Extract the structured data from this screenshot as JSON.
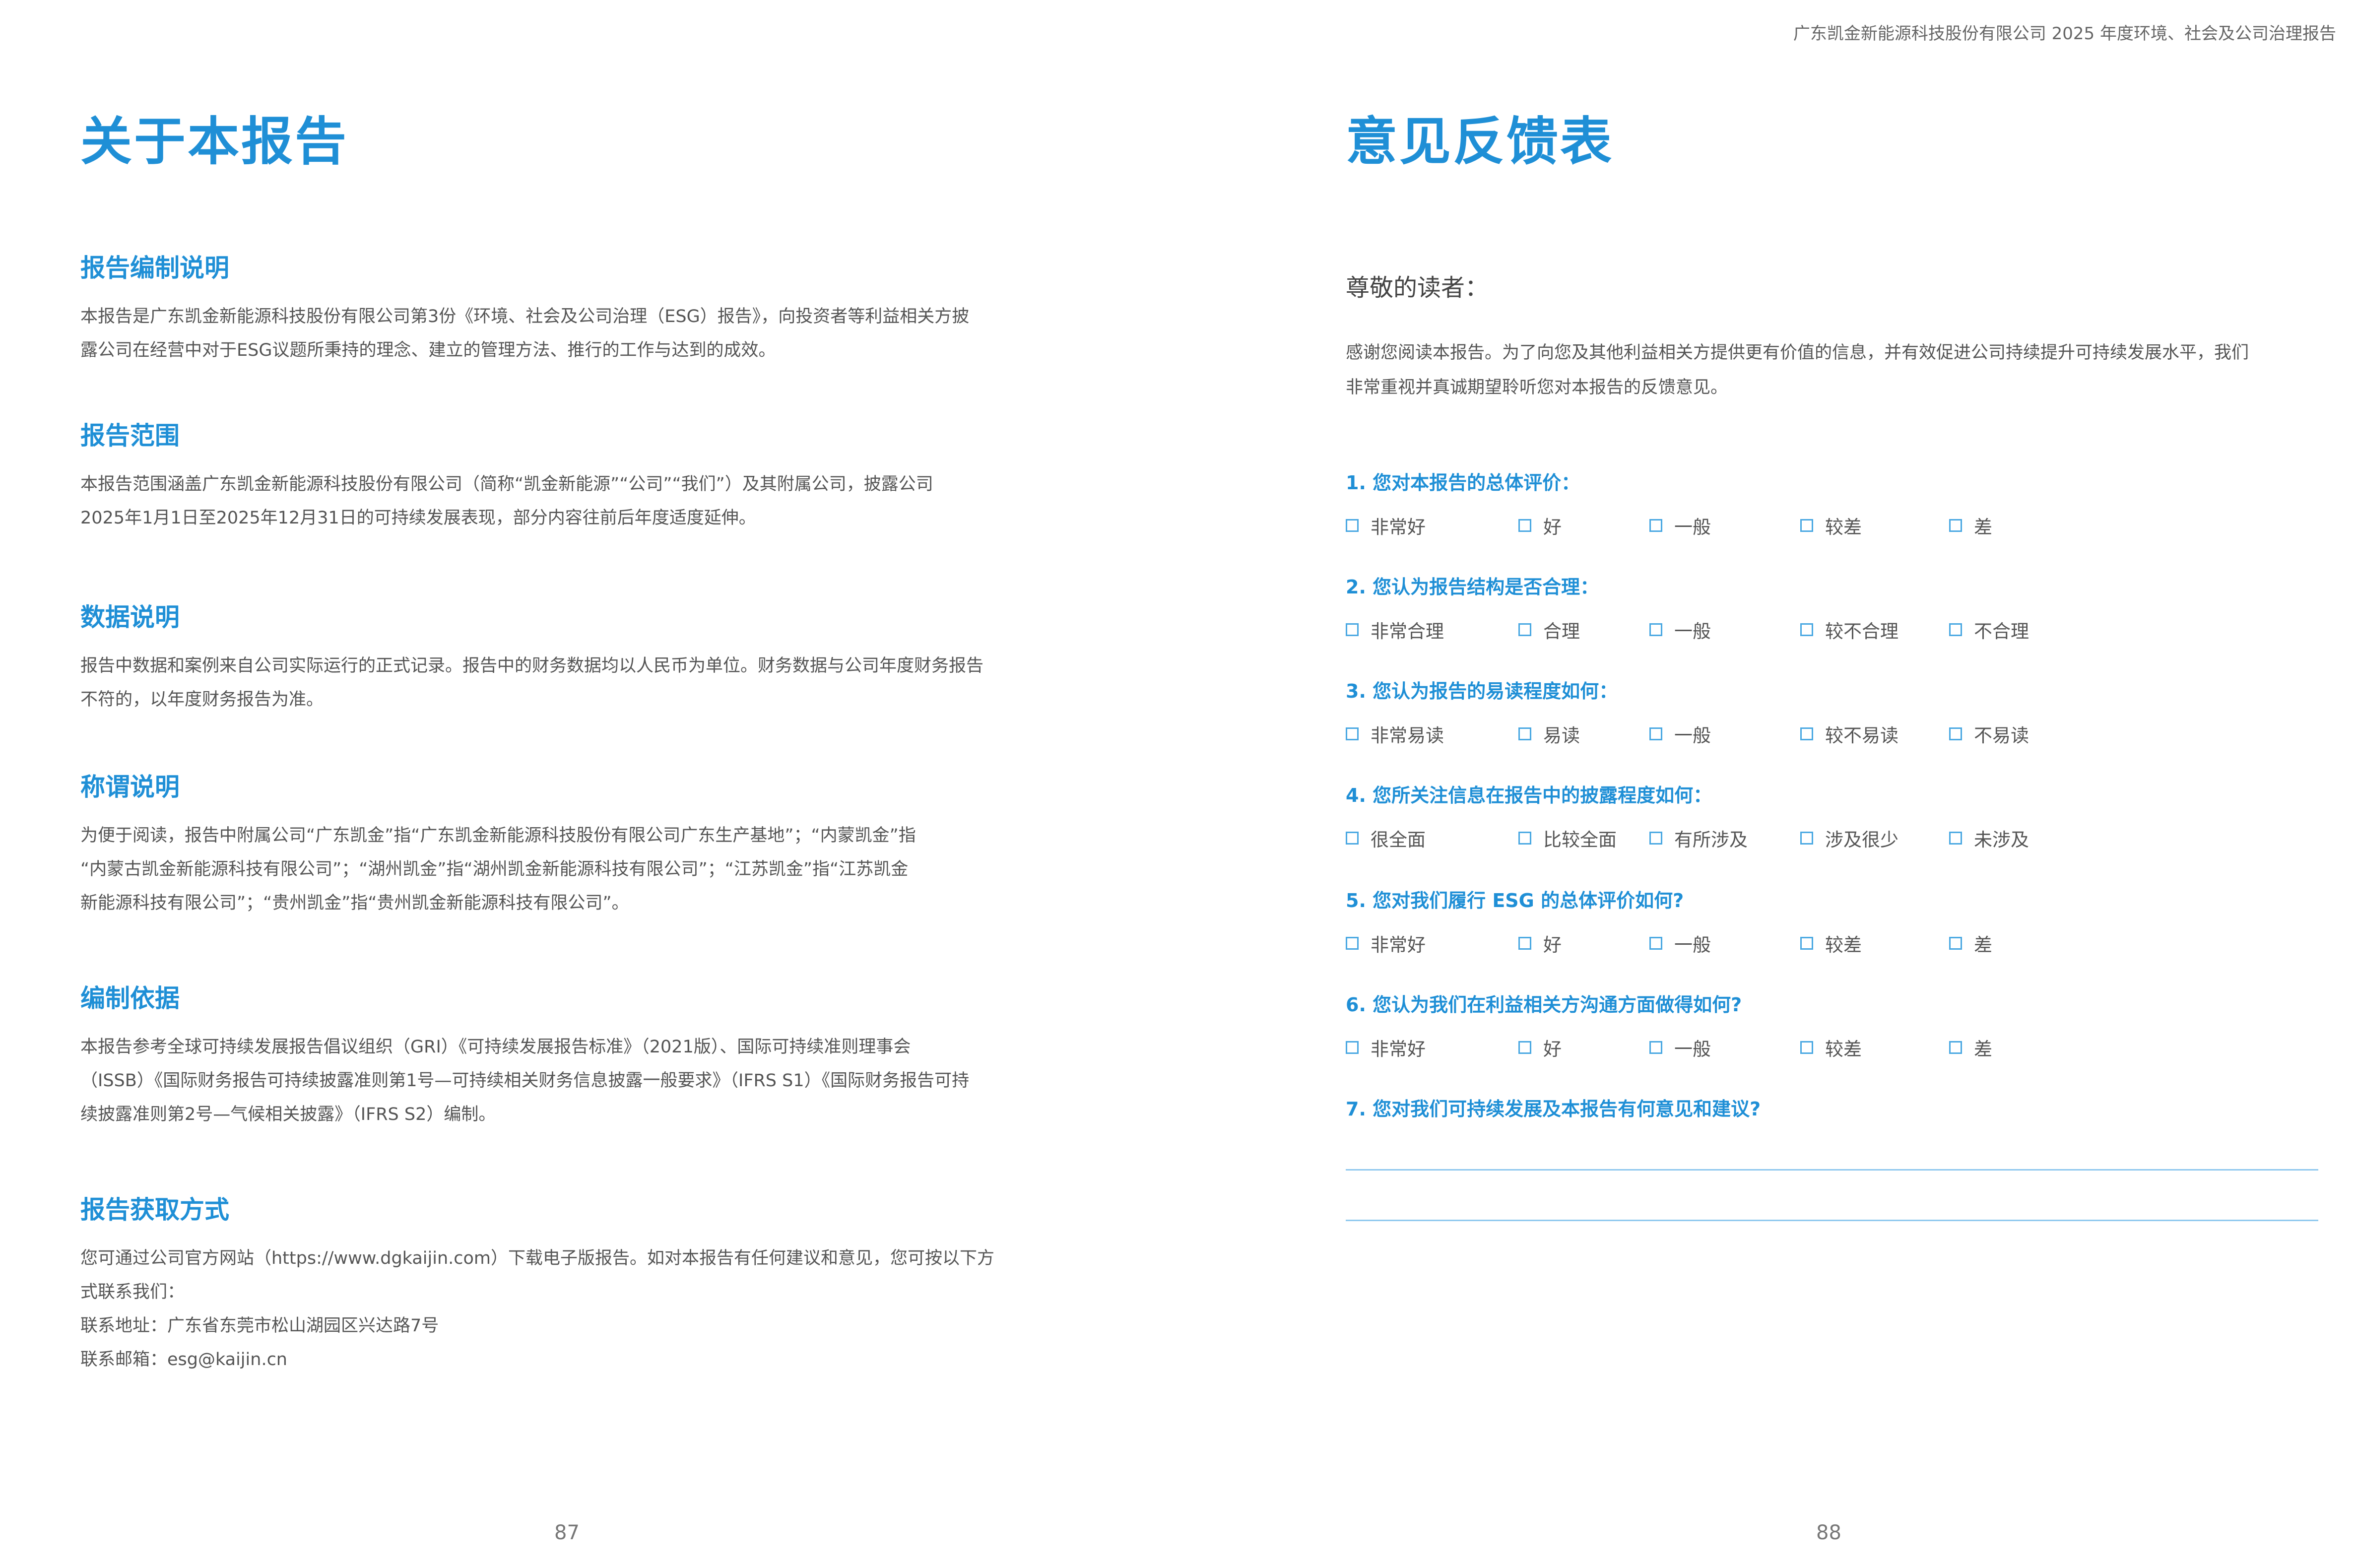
{
  "header": {
    "running_title": "广东凯金新能源科技股份有限公司  2025 年度环境、社会及公司治理报告"
  },
  "left_page": {
    "title": "关于本报告",
    "page_number": "87",
    "sections": [
      {
        "heading": "报告编制说明",
        "lines": [
          "本报告是广东凯金新能源科技股份有限公司第3份《环境、社会及公司治理（ESG）报告》，向投资者等利益相关方披",
          "露公司在经营中对于ESG议题所秉持的理念、建立的管理方法、推行的工作与达到的成效。"
        ]
      },
      {
        "heading": "报告范围",
        "lines": [
          "本报告范围涵盖广东凯金新能源科技股份有限公司（简称“凯金新能源”“公司”“我们”）及其附属公司，披露公司",
          "2025年1月1日至2025年12月31日的可持续发展表现，部分内容往前后年度适度延伸。"
        ]
      },
      {
        "heading": "数据说明",
        "lines": [
          "报告中数据和案例来自公司实际运行的正式记录。报告中的财务数据均以人民币为单位。财务数据与公司年度财务报告",
          "不符的，以年度财务报告为准。"
        ]
      },
      {
        "heading": "称谓说明",
        "lines": [
          "为便于阅读，报告中附属公司“广东凯金”指“广东凯金新能源科技股份有限公司广东生产基地”；“内蒙凯金”指",
          "“内蒙古凯金新能源科技有限公司”；“湖州凯金”指“湖州凯金新能源科技有限公司”；“江苏凯金”指“江苏凯金",
          "新能源科技有限公司”；“贵州凯金”指“贵州凯金新能源科技有限公司”。"
        ]
      },
      {
        "heading": "编制依据",
        "lines": [
          "本报告参考全球可持续发展报告倡议组织（GRI）《可持续发展报告标准》（2021版）、国际可持续准则理事会",
          "（ISSB）《国际财务报告可持续披露准则第1号—可持续相关财务信息披露一般要求》（IFRS S1）《国际财务报告可持",
          "续披露准则第2号—气候相关披露》（IFRS S2）编制。"
        ]
      },
      {
        "heading": "报告获取方式",
        "lines": [
          "您可通过公司官方网站（https://www.dgkaijin.com）下载电子版报告。如对本报告有任何建议和意见，您可按以下方",
          "式联系我们：",
          "联系地址：广东省东莞市松山湖园区兴达路7号",
          "联系邮箱：esg@kaijin.cn"
        ]
      }
    ]
  },
  "right_page": {
    "title": "意见反馈表",
    "page_number": "88",
    "salutation": "尊敬的读者：",
    "intro_lines": [
      "感谢您阅读本报告。为了向您及其他利益相关方提供更有价值的信息，并有效促进公司持续提升可持续发展水平，我们",
      "非常重视并真诚期望聆听您对本报告的反馈意见。"
    ],
    "questions": [
      {
        "label": "1. 您对本报告的总体评价：",
        "options": [
          "非常好",
          "好",
          "一般",
          "较差",
          "差"
        ]
      },
      {
        "label": "2. 您认为报告结构是否合理：",
        "options": [
          "非常合理",
          "合理",
          "一般",
          "较不合理",
          "不合理"
        ]
      },
      {
        "label": "3. 您认为报告的易读程度如何：",
        "options": [
          "非常易读",
          "易读",
          "一般",
          "较不易读",
          "不易读"
        ]
      },
      {
        "label": "4. 您所关注信息在报告中的披露程度如何：",
        "options": [
          "很全面",
          "比较全面",
          "有所涉及",
          "涉及很少",
          "未涉及"
        ]
      },
      {
        "label": "5. 您对我们履行 ESG 的总体评价如何?",
        "options": [
          "非常好",
          "好",
          "一般",
          "较差",
          "差"
        ]
      },
      {
        "label": "6. 您认为我们在利益相关方沟通方面做得如何?",
        "options": [
          "非常好",
          "好",
          "一般",
          "较差",
          "差"
        ]
      },
      {
        "label": "7. 您对我们可持续发展及本报告有何意见和建议?",
        "options": []
      }
    ]
  }
}
